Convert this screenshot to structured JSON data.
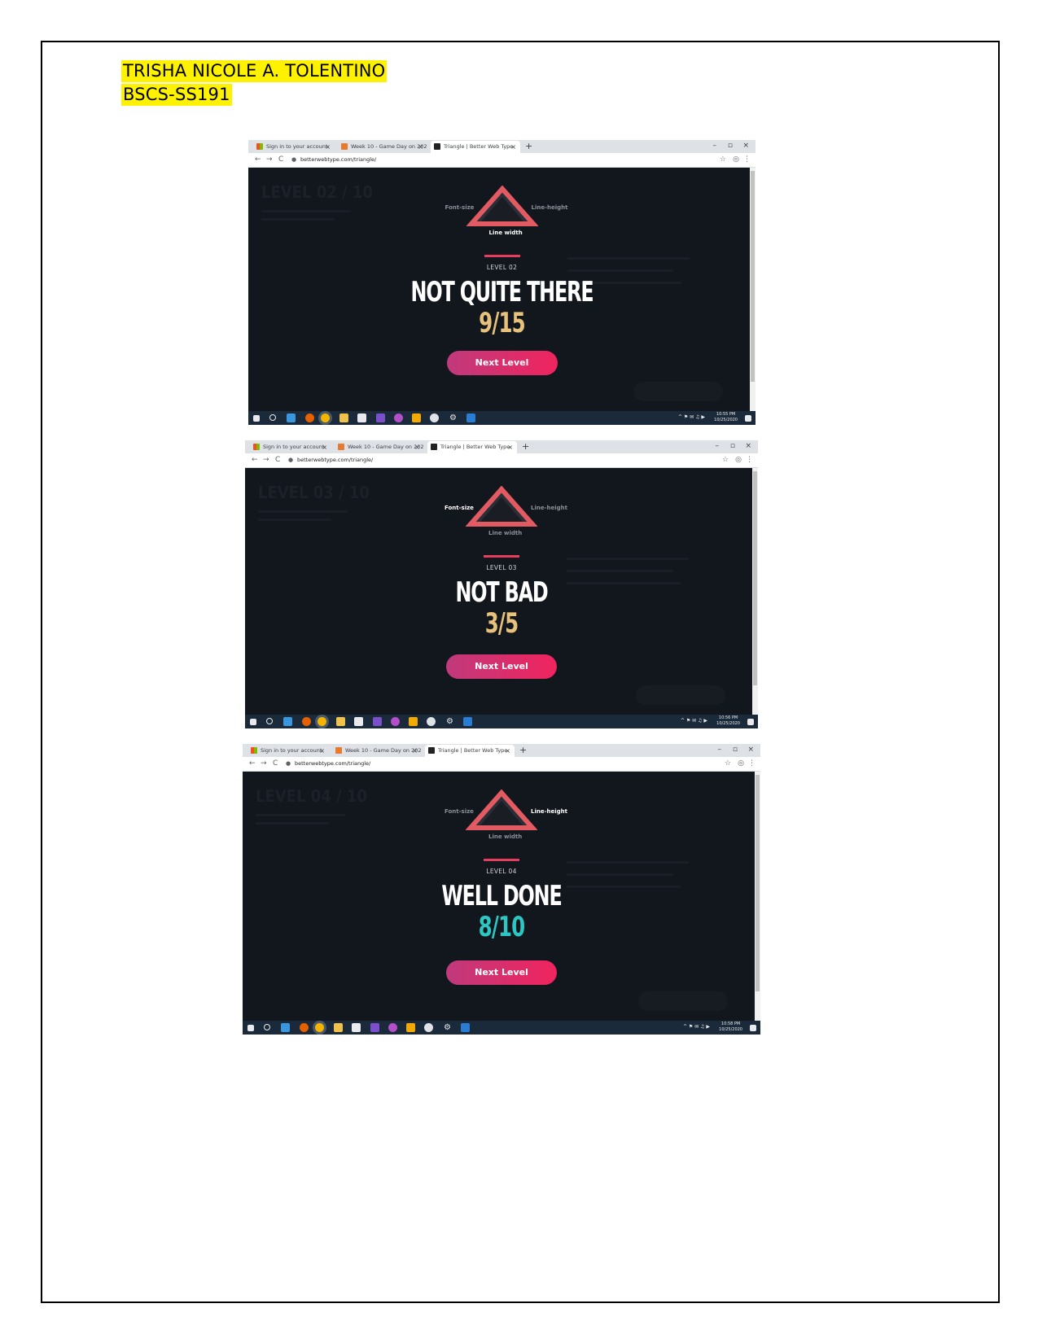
{
  "header": {
    "name": "TRISHA NICOLE A. TOLENTINO",
    "section": "BSCS-SS191"
  },
  "browser": {
    "tabs": [
      "Sign in to your account",
      "Week 10 - Game Day on 202071",
      "Triangle | Better Web Type"
    ],
    "new_tab": "+",
    "url": "betterwebtype.com/triangle/",
    "win_min": "–",
    "win_max": "▫",
    "win_close": "×",
    "tab_close": "×",
    "nav_back": "←",
    "nav_fwd": "→",
    "nav_reload": "C",
    "star": "☆"
  },
  "triangle_labels": {
    "font_size": "Font-size",
    "line_height": "Line-height",
    "line_width": "Line width"
  },
  "next_button": "Next Level",
  "screens": [
    {
      "level": "LEVEL 02",
      "result": "NOT QUITE THERE",
      "score": "9/15",
      "score_color": "#e8c27a",
      "clock": "10:55 PM",
      "date": "10/25/2020",
      "ghost": "LEVEL 02 / 10",
      "highlight": "line_width"
    },
    {
      "level": "LEVEL 03",
      "result": "NOT BAD",
      "score": "3/5",
      "score_color": "#e8c27a",
      "clock": "10:56 PM",
      "date": "10/25/2020",
      "ghost": "LEVEL 03 / 10",
      "highlight": "font_size"
    },
    {
      "level": "LEVEL 04",
      "result": "WELL DONE",
      "score": "8/10",
      "score_color": "#2cc7c3",
      "clock": "10:58 PM",
      "date": "10/25/2020",
      "ghost": "LEVEL 04 / 10",
      "highlight": "line_height"
    }
  ],
  "colors": {
    "highlight_yellow": "#fff200",
    "accent_red": "#e63e5c",
    "page_bg": "#12161d"
  }
}
